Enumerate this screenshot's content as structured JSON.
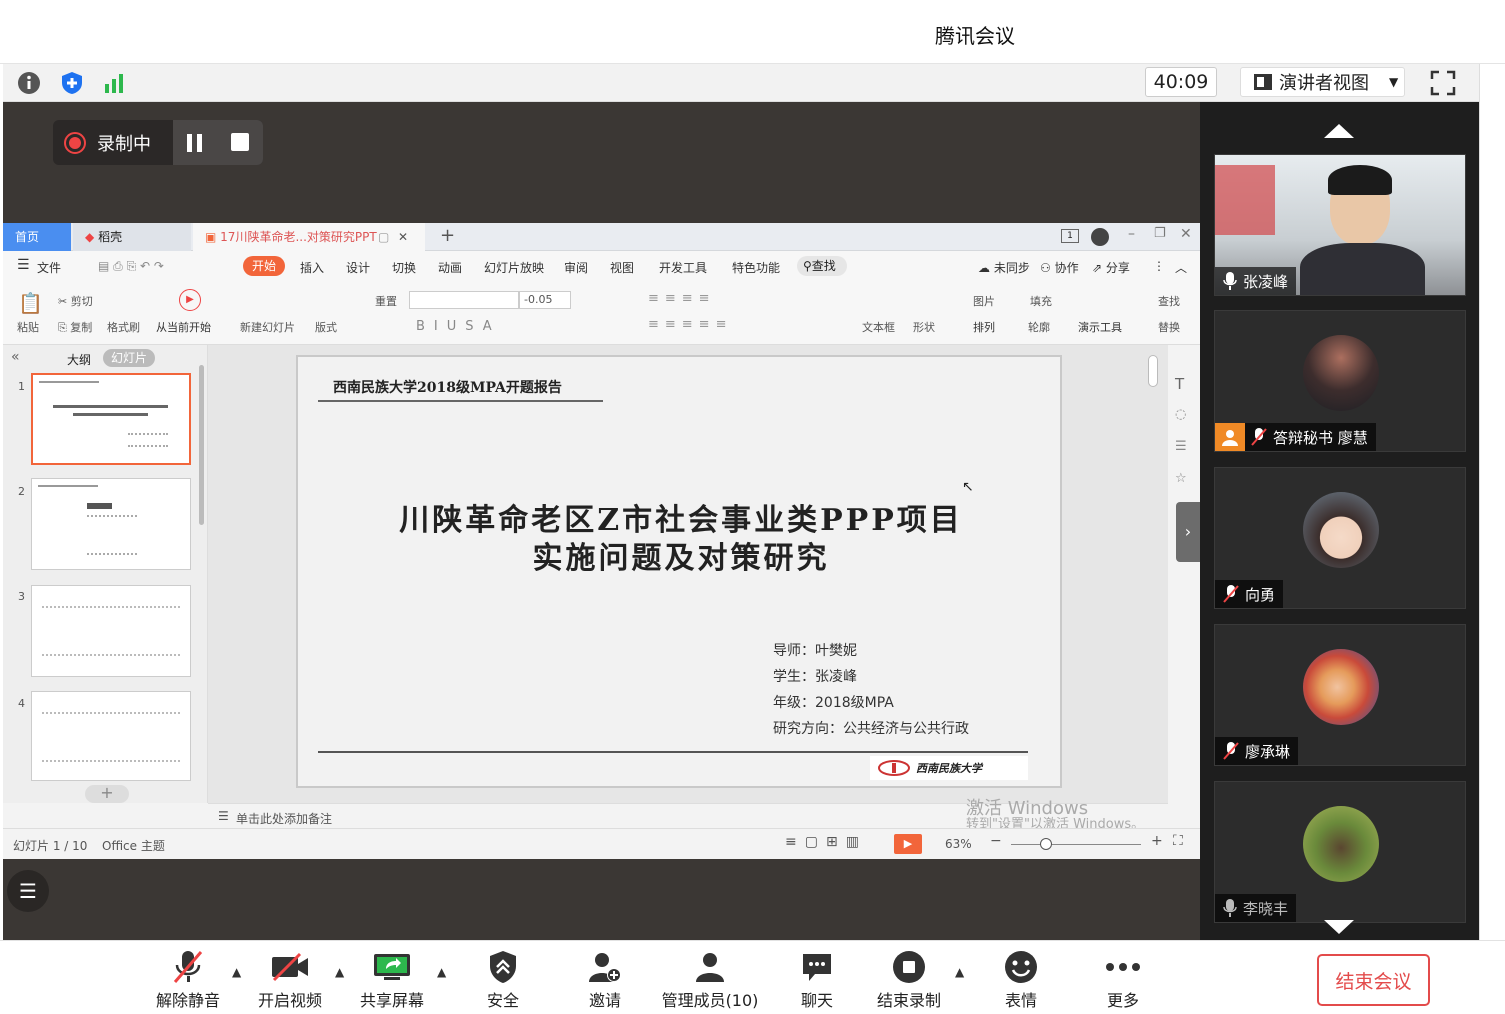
{
  "window": {
    "title": "腾讯会议"
  },
  "topbar": {
    "timer": "40:09",
    "view_mode": "演讲者视图"
  },
  "recording": {
    "label": "录制中"
  },
  "wps": {
    "tabs": [
      "首页",
      "稻壳",
      "17川陕革命老...对策研究PPT"
    ],
    "menu": [
      "文件",
      "开始",
      "插入",
      "设计",
      "切换",
      "动画",
      "幻灯片放映",
      "审阅",
      "视图",
      "开发工具",
      "特色功能",
      "查找"
    ],
    "menu_right": [
      "未同步",
      "协作",
      "分享"
    ],
    "ribbon": {
      "paste": "粘贴",
      "cut": "剪切",
      "copy": "复制",
      "format_painter": "格式刷",
      "play_from_current": "从当前开始",
      "new_slide": "新建幻灯片",
      "layout": "版式",
      "reset": "重置",
      "font_size": "-0.05",
      "textbox": "文本框",
      "shape": "形状",
      "picture": "图片",
      "fill": "填充",
      "arrange": "排列",
      "outline": "轮廓",
      "presenter_tools": "演示工具",
      "find": "查找",
      "replace": "替换"
    },
    "panel_tabs": [
      "大纲",
      "幻灯片"
    ],
    "thumb_numbers": [
      "1",
      "2",
      "3",
      "4"
    ],
    "notes_placeholder": "单击此处添加备注",
    "status": {
      "slide": "幻灯片 1 / 10",
      "theme": "Office 主题",
      "zoom": "63%"
    },
    "watermark_line1": "激活 Windows",
    "watermark_line2": "转到\"设置\"以激活 Windows。"
  },
  "slide": {
    "header": "西南民族大学2018级MPA开题报告",
    "title_line1": "川陕革命老区Z市社会事业类PPP项目",
    "title_line2": "实施问题及对策研究",
    "advisor": "导师：叶樊妮",
    "student": "学生：张凌峰",
    "grade": "年级：2018级MPA",
    "direction": "研究方向：公共经济与公共行政",
    "logo_text": "西南民族大学"
  },
  "participants": [
    {
      "name": "张凌峰",
      "muted": false
    },
    {
      "name": "答辩秘书 廖慧",
      "muted": true
    },
    {
      "name": "向勇",
      "muted": true
    },
    {
      "name": "廖承琳",
      "muted": true
    },
    {
      "name": "李晓丰",
      "muted": false
    }
  ],
  "bottombar": {
    "unmute": "解除静音",
    "start_video": "开启视频",
    "share_screen": "共享屏幕",
    "security": "安全",
    "invite": "邀请",
    "manage_members": "管理成员(10)",
    "chat": "聊天",
    "end_recording": "结束录制",
    "reactions": "表情",
    "more": "更多",
    "end_meeting": "结束会议"
  },
  "colors": {
    "accent_orange": "#f2653a",
    "end_red": "#e34b4b",
    "wps_blue": "#4a8ef0"
  }
}
